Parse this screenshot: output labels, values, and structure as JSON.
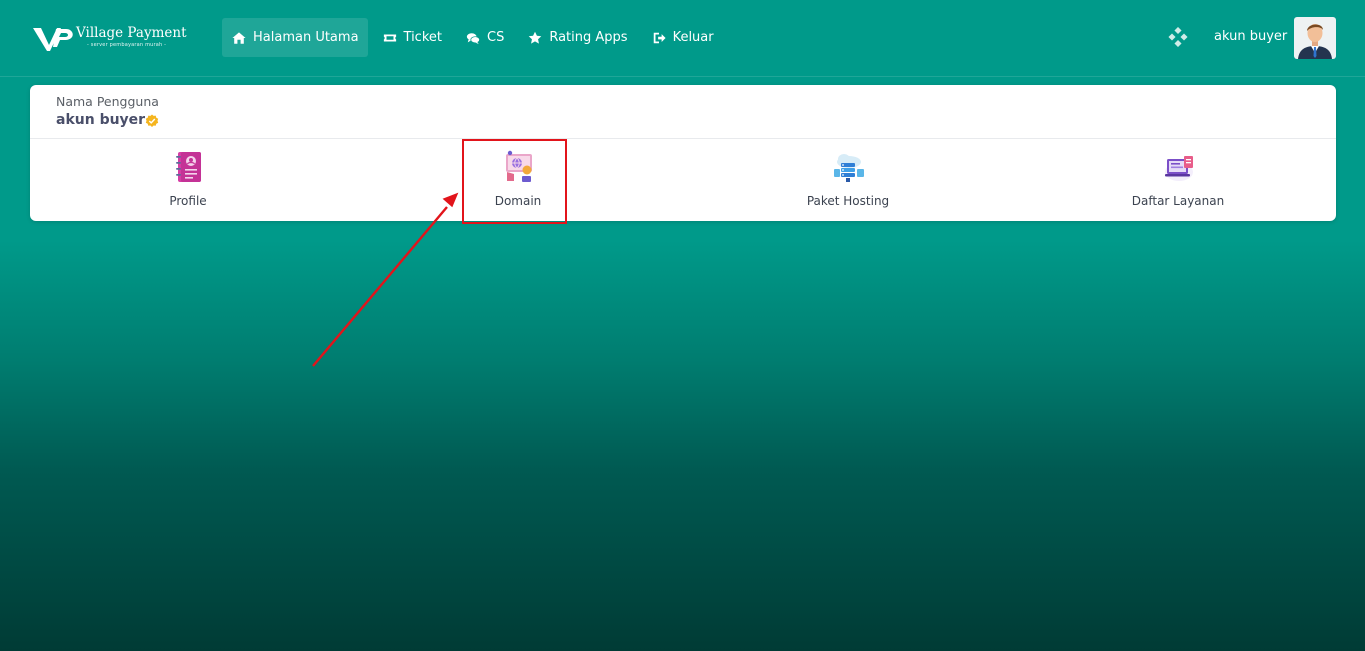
{
  "brand": {
    "name": "Village Payment",
    "tagline": "- server pembayaran murah -"
  },
  "nav": {
    "items": [
      {
        "label": "Halaman Utama",
        "icon": "home-icon",
        "active": true
      },
      {
        "label": "Ticket",
        "icon": "ticket-icon",
        "active": false
      },
      {
        "label": "CS",
        "icon": "chat-icon",
        "active": false
      },
      {
        "label": "Rating Apps",
        "icon": "star-icon",
        "active": false
      },
      {
        "label": "Keluar",
        "icon": "logout-icon",
        "active": false
      }
    ],
    "user_name": "akun buyer"
  },
  "profile_card": {
    "label": "Nama Pengguna",
    "username": "akun buyer",
    "menu": [
      {
        "label": "Profile",
        "icon": "profile-book-icon"
      },
      {
        "label": "Domain",
        "icon": "domain-icon"
      },
      {
        "label": "Paket Hosting",
        "icon": "hosting-icon"
      },
      {
        "label": "Daftar Layanan",
        "icon": "service-list-icon"
      }
    ]
  },
  "colors": {
    "background": "#009a8a",
    "highlight": "#e2141b",
    "verified": "#f5b51f"
  }
}
